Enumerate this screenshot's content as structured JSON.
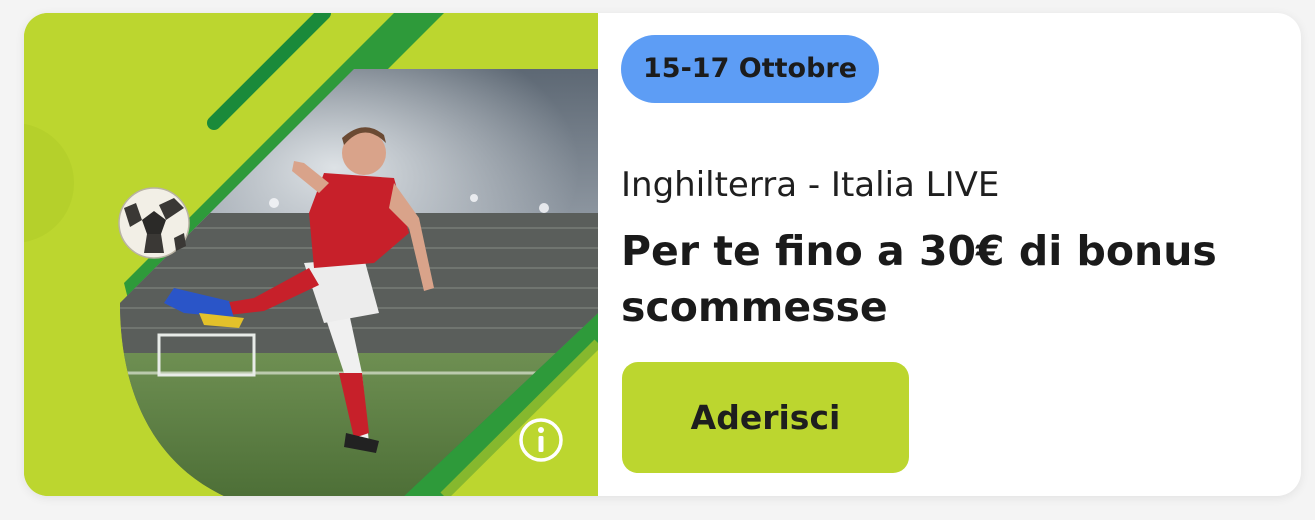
{
  "promo": {
    "date_badge": "15-17 Ottobre",
    "subtitle": "Inghilterra - Italia LIVE",
    "headline": "Per te fino a 30€ di bonus scommesse",
    "cta_label": "Aderisci"
  },
  "icons": {
    "info": "info-icon",
    "ball": "soccer-ball-icon"
  },
  "colors": {
    "brand_green": "#bcd62f",
    "dark_green": "#1a8a3a",
    "badge_blue": "#5d9df5",
    "text_dark": "#1a1a1a",
    "card_bg": "#ffffff"
  }
}
